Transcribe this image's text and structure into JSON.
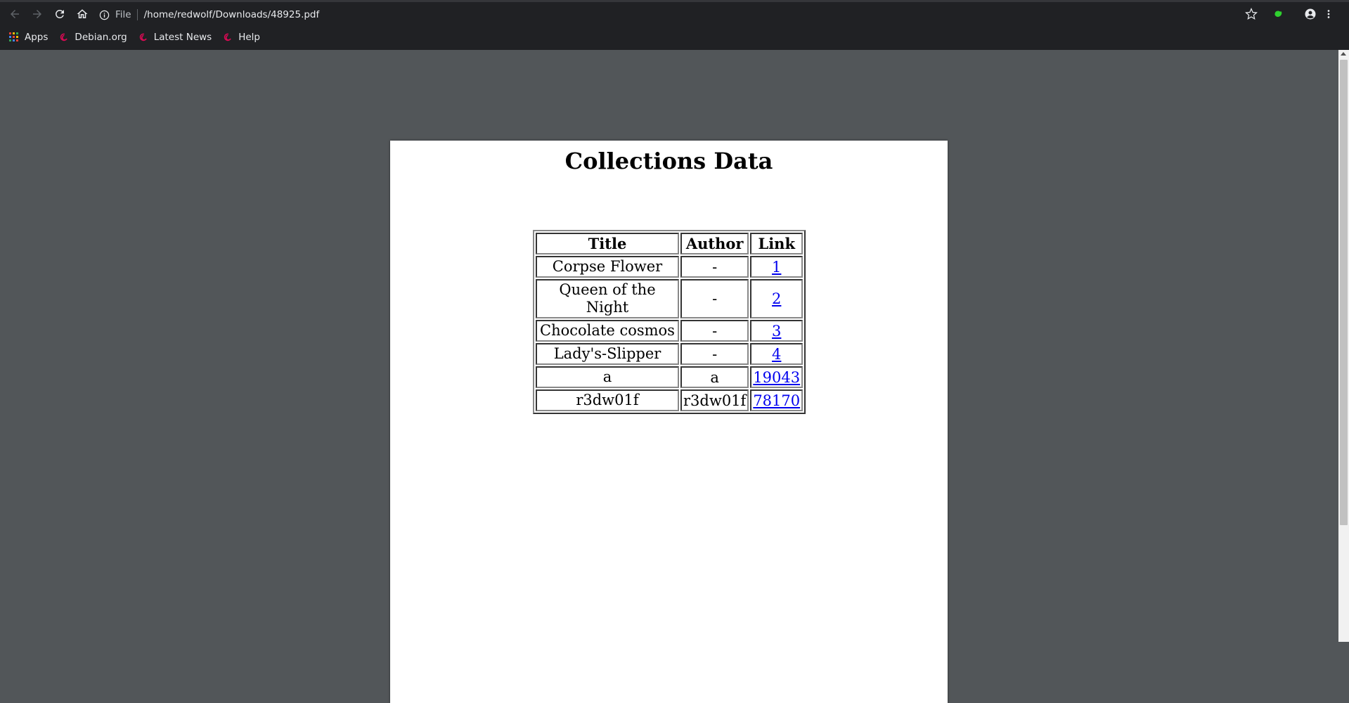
{
  "browser": {
    "omnibox": {
      "scheme": "File",
      "url": "/home/redwolf/Downloads/48925.pdf",
      "info_icon": "info-icon"
    },
    "nav_icons": [
      "back-arrow-icon",
      "forward-arrow-icon",
      "reload-icon",
      "home-icon"
    ],
    "right_icons": [
      "bookmark-star-icon",
      "extension-icon",
      "account-icon",
      "menu-icon"
    ],
    "bookmarks": [
      {
        "label": "Apps",
        "icon": "apps-grid-icon"
      },
      {
        "label": "Debian.org",
        "icon": "debian-swirl-icon"
      },
      {
        "label": "Latest News",
        "icon": "debian-swirl-icon"
      },
      {
        "label": "Help",
        "icon": "debian-swirl-icon"
      }
    ],
    "colors": {
      "chrome": "#202124",
      "viewer_bg": "#525659",
      "link": "#0000ee"
    }
  },
  "document": {
    "title": "Collections Data",
    "table": {
      "headers": [
        "Title",
        "Author",
        "Link"
      ],
      "rows": [
        {
          "title": "Corpse Flower",
          "author": "-",
          "link": "1"
        },
        {
          "title": "Queen of the Night",
          "author": "-",
          "link": "2"
        },
        {
          "title": "Chocolate cosmos",
          "author": "-",
          "link": "3"
        },
        {
          "title": "Lady's-Slipper",
          "author": "-",
          "link": "4"
        },
        {
          "title": "a",
          "author": "a",
          "link": "19043"
        },
        {
          "title": "r3dw01f",
          "author": "r3dw01f",
          "link": "78170"
        }
      ]
    }
  }
}
